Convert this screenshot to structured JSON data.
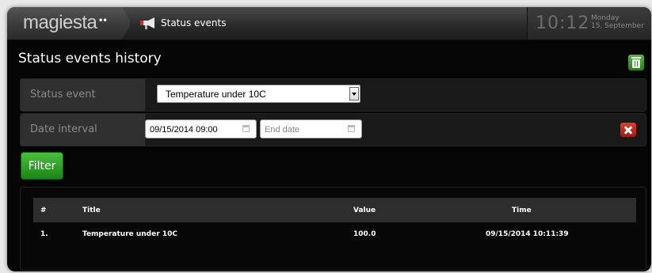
{
  "header": {
    "logo": "magiesta",
    "logo_mark": "••",
    "section_title": "Status events",
    "time": "10:12",
    "weekday": "Monday",
    "date": "15. September"
  },
  "page": {
    "title": "Status events history"
  },
  "filters": {
    "status_event_label": "Status event",
    "status_event_value": "Temperature under 10C",
    "date_interval_label": "Date interval",
    "start_date_value": "09/15/2014 09:00",
    "end_date_placeholder": "End date",
    "filter_label": "Filter"
  },
  "table": {
    "columns": [
      "#",
      "Title",
      "Value",
      "Time"
    ],
    "rows": [
      {
        "index": "1.",
        "title": "Temperature under 10C",
        "value": "100.0",
        "time": "09/15/2014 10:11:39"
      }
    ]
  },
  "icons": {
    "trash": "trash-icon",
    "clear": "clear-icon",
    "megaphone": "megaphone-icon",
    "calendar": "calendar-icon"
  },
  "colors": {
    "accent_green": "#2f9e2a",
    "delete_red": "#c9281b",
    "background": "#050505"
  }
}
